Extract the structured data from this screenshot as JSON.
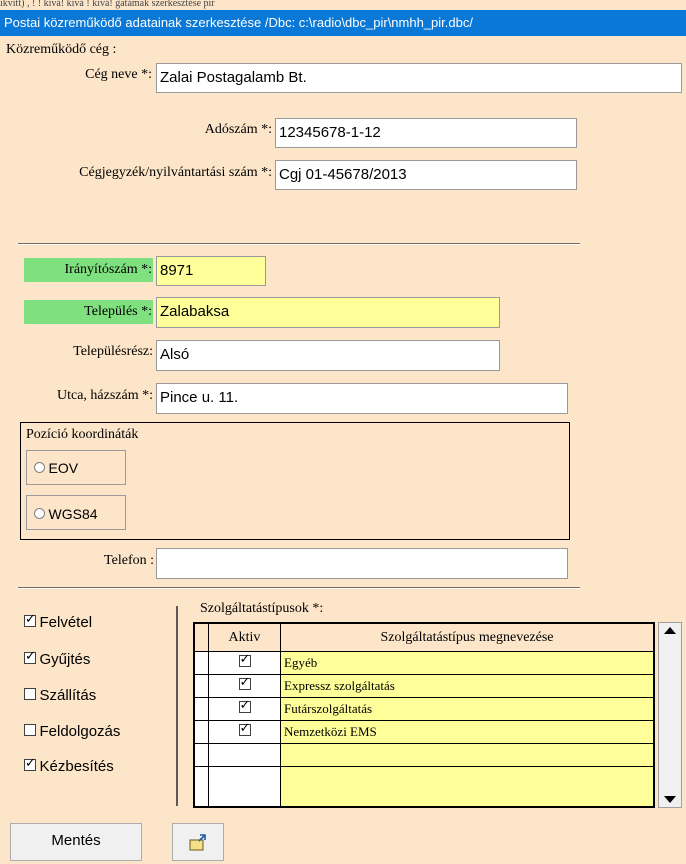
{
  "window": {
    "top_strip": "ikvítt) , ! ! kivá! kivá ! kivá!  gatámak szerkesztése  pir",
    "title": "Postai közreműködő adatainak szerkesztése  /Dbc: c:\\radio\\dbc_pir\\nmhh_pir.dbc/"
  },
  "company": {
    "section_label": "Közreműködő cég :",
    "name_label": "Cég neve *:",
    "name_value": "Zalai Postagalamb Bt.",
    "tax_label": "Adószám *:",
    "tax_value": "12345678-1-12",
    "reg_label": "Cégjegyzék/nyilvántartási szám *:",
    "reg_value": "Cgj 01-45678/2013"
  },
  "address": {
    "zip_label": "Irányítószám *:",
    "zip_value": "8971",
    "city_label": "Település *:",
    "city_value": "Zalabaksa",
    "district_label": "Településrész:",
    "district_value": "Alsó",
    "street_label": "Utca, házszám *:",
    "street_value": "Pince u. 11."
  },
  "position": {
    "group_label": "Pozíció koordináták",
    "options": [
      "EOV",
      "WGS84"
    ]
  },
  "phone": {
    "label": "Telefon :",
    "value": ""
  },
  "activities": [
    {
      "label": "Felvétel",
      "checked": true
    },
    {
      "label": "Gyűjtés",
      "checked": true
    },
    {
      "label": "Szállítás",
      "checked": false
    },
    {
      "label": "Feldolgozás",
      "checked": false
    },
    {
      "label": "Kézbesítés",
      "checked": true
    }
  ],
  "services": {
    "label": "Szolgáltatástípusok *:",
    "columns": [
      "Aktiv",
      "Szolgáltatástípus megnevezése"
    ],
    "rows": [
      {
        "active": true,
        "name": "Egyéb"
      },
      {
        "active": true,
        "name": "Expressz szolgáltatás"
      },
      {
        "active": true,
        "name": "Futárszolgáltatás"
      },
      {
        "active": true,
        "name": "Nemzetközi EMS"
      }
    ]
  },
  "buttons": {
    "save": "Mentés"
  },
  "colors": {
    "background": "#fce5c8",
    "title_bar": "#0a78d7",
    "required_label": "#7fe07f",
    "required_field": "#ffff99"
  }
}
